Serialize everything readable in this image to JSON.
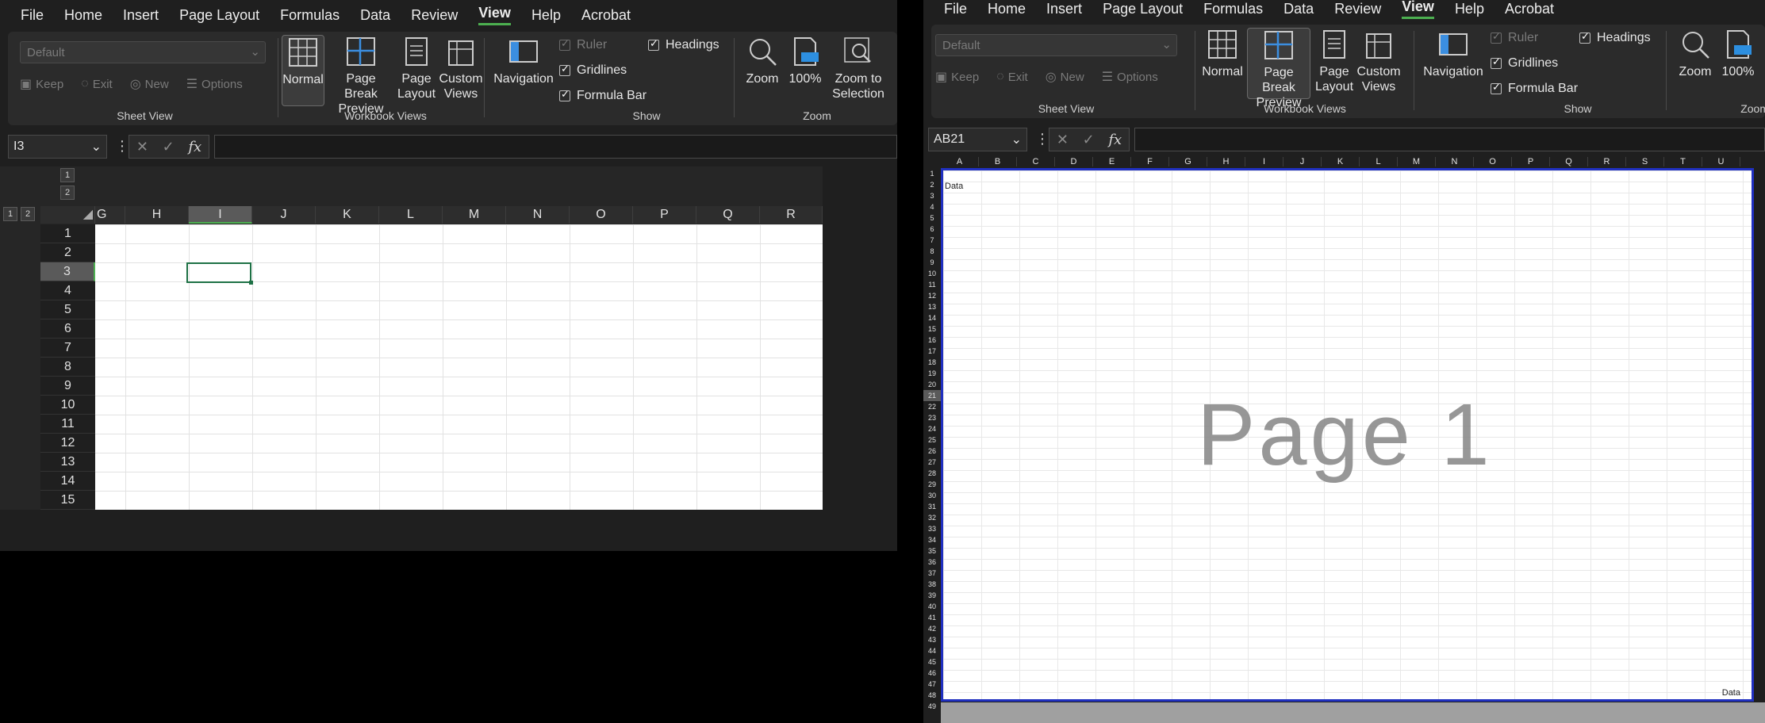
{
  "menu": [
    "File",
    "Home",
    "Insert",
    "Page Layout",
    "Formulas",
    "Data",
    "Review",
    "View",
    "Help",
    "Acrobat"
  ],
  "active_menu": "View",
  "ribbon": {
    "sheet_view": {
      "dropdown_value": "Default",
      "buttons": [
        "Keep",
        "Exit",
        "New",
        "Options"
      ],
      "label": "Sheet View"
    },
    "workbook_views": {
      "buttons": [
        "Normal",
        "Page Break Preview",
        "Page Layout",
        "Custom Views"
      ],
      "label": "Workbook Views"
    },
    "navigation": "Navigation",
    "show": {
      "ruler": "Ruler",
      "gridlines": "Gridlines",
      "formula_bar": "Formula Bar",
      "headings": "Headings",
      "label": "Show"
    },
    "zoom": {
      "buttons": [
        "Zoom",
        "100%",
        "Zoom to Selection"
      ],
      "label": "Zoom"
    }
  },
  "left": {
    "name_box": "I3",
    "outline_levels_top": [
      "1",
      "2"
    ],
    "outline_levels_side": [
      "1",
      "2"
    ],
    "columns": [
      "G",
      "H",
      "I",
      "J",
      "K",
      "L",
      "M",
      "N",
      "O",
      "P",
      "Q",
      "R"
    ],
    "selected_column": "I",
    "rows": [
      "1",
      "2",
      "3",
      "4",
      "5",
      "6",
      "7",
      "8",
      "9",
      "10",
      "11",
      "12",
      "13",
      "14",
      "15"
    ],
    "selected_row": "3"
  },
  "right": {
    "name_box": "AB21",
    "columns": [
      "A",
      "B",
      "C",
      "D",
      "E",
      "F",
      "G",
      "H",
      "I",
      "J",
      "K",
      "L",
      "M",
      "N",
      "O",
      "P",
      "Q",
      "R",
      "S",
      "T",
      "U"
    ],
    "rows_count": 49,
    "selected_row": "21",
    "watermark": "Page 1",
    "cell_a2": "Data",
    "cell_bottom_right": "Data"
  },
  "colors": {
    "accent_green": "#4caf50",
    "page_border": "#2030c0",
    "ribbon_bg": "#2b2b2b"
  }
}
